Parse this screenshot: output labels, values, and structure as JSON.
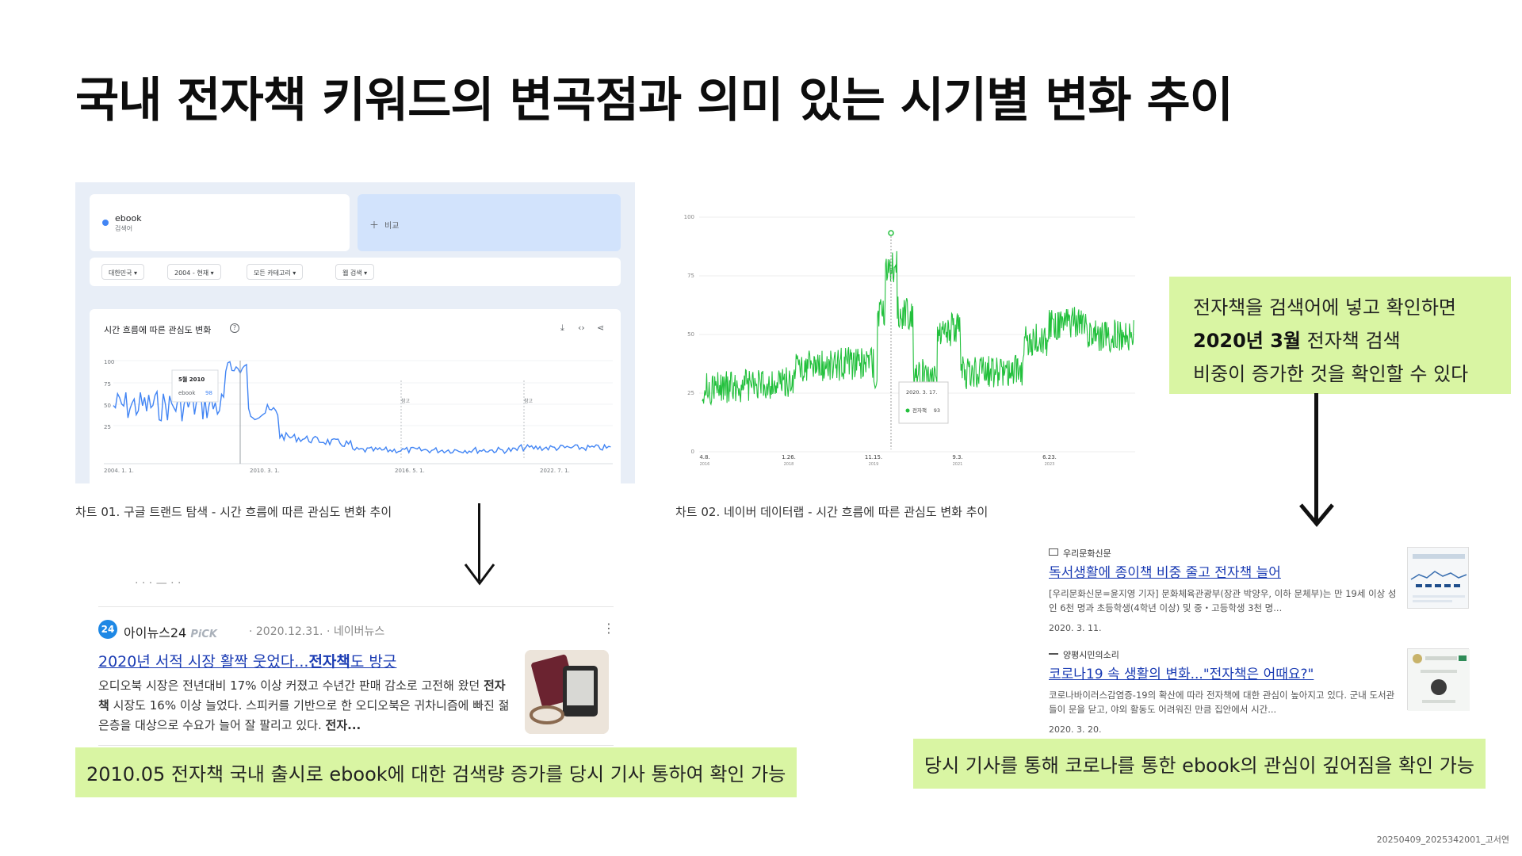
{
  "slide": {
    "title": "국내 전자책 키워드의 변곡점과 의미 있는 시기별 변화 추이",
    "footer": "20250409_2025342001_고서연"
  },
  "google_trends": {
    "term": "ebook",
    "term_sub": "검색어",
    "compare_label": "비교",
    "filters": [
      "대한민국 ▾",
      "2004 - 현재 ▾",
      "모든 카테고리 ▾",
      "웹 검색 ▾"
    ],
    "chart_title": "시간 흐름에 따른 관심도 변화",
    "tooltip_date": "5월 2010",
    "tooltip_term": "ebook",
    "tooltip_value": "98",
    "y_ticks": [
      "100",
      "75",
      "50",
      "25"
    ],
    "x_ticks": [
      "2004. 1. 1.",
      "2010. 3. 1.",
      "2016. 5. 1.",
      "2022. 7. 1."
    ],
    "note_markers": [
      "참고",
      "참고"
    ],
    "series_color": "#4285f4",
    "caption": "차트 01. 구글 트랜드 탐색 - 시간 흐름에 따른 관심도 변화 추이"
  },
  "naver_datalab": {
    "y_ticks": [
      "100",
      "75",
      "50",
      "25",
      "0"
    ],
    "x_ticks": [
      {
        "md": "4.8.",
        "y": "2016"
      },
      {
        "md": "1.26.",
        "y": "2018"
      },
      {
        "md": "11.15.",
        "y": "2019"
      },
      {
        "md": "9.3.",
        "y": "2021"
      },
      {
        "md": "6.23.",
        "y": "2023"
      }
    ],
    "tooltip_date": "2020. 3. 17.",
    "tooltip_term": "전자책",
    "tooltip_value": "93",
    "series_color": "#22c03c",
    "caption": "차트 02. 네이버 데이터랩 - 시간 흐름에 따른 관심도 변화 추이"
  },
  "callout": {
    "line1": "전자책을 검색어에 넣고 확인하면",
    "line2_bold": "2020년 3월",
    "line2_rest": " 전자책 검색",
    "line3": "비중이 증가한 것을 확인할 수 있다"
  },
  "news_left": {
    "logo": "24",
    "publisher": "아이뉴스24",
    "pick": "PiCK",
    "meta": "· 2020.12.31. · 네이버뉴스",
    "headline_pre": "2020년 서적 시장 활짝 웃었다...",
    "headline_bold": "전자책",
    "headline_post": "도 방긋",
    "body_pre": "오디오북 시장은 전년대비 17% 이상 커졌고 수년간 판매 감소로 고전해 왔던 ",
    "body_bold": "전자책",
    "body_post": " 시장도 16% 이상 늘었다. 스피커를 기반으로 한 오디오북은 귀차니즘에 빠진 젊은층을 대상으로 수요가 늘어 잘 팔리고 있다. ",
    "body_tail_bold": "전자...",
    "label": "2010.05 전자책 국내 출시로 ebook에 대한 검색량 증가를 당시 기사 통하여 확인 가능"
  },
  "news_right": {
    "items": [
      {
        "source": "우리문화신문",
        "headline": "독서생활에 종이책 비중 줄고 전자책 늘어",
        "body": "[우리문화신문=윤지영 기자] 문화체육관광부(장관 박양우, 이하 문체부)는 만 19세 이상 성인 6천 명과 초등학생(4학년 이상) 및 중・고등학생 3천 명...",
        "date": "2020. 3. 11."
      },
      {
        "source": "양평시민의소리",
        "headline": "코로나19 속 생활의 변화...\"전자책은 어때요?\"",
        "body": "코로나바이러스감염증-19의 확산에 따라 전자책에 대한 관심이 높아지고 있다. 군내 도서관들이 문을 닫고, 야외 활동도 어려워진 만큼 집안에서 시간...",
        "date": "2020. 3. 20."
      }
    ],
    "label": "당시 기사를 통해 코로나를 통한 ebook의 관심이 깊어짐을 확인 가능"
  }
}
